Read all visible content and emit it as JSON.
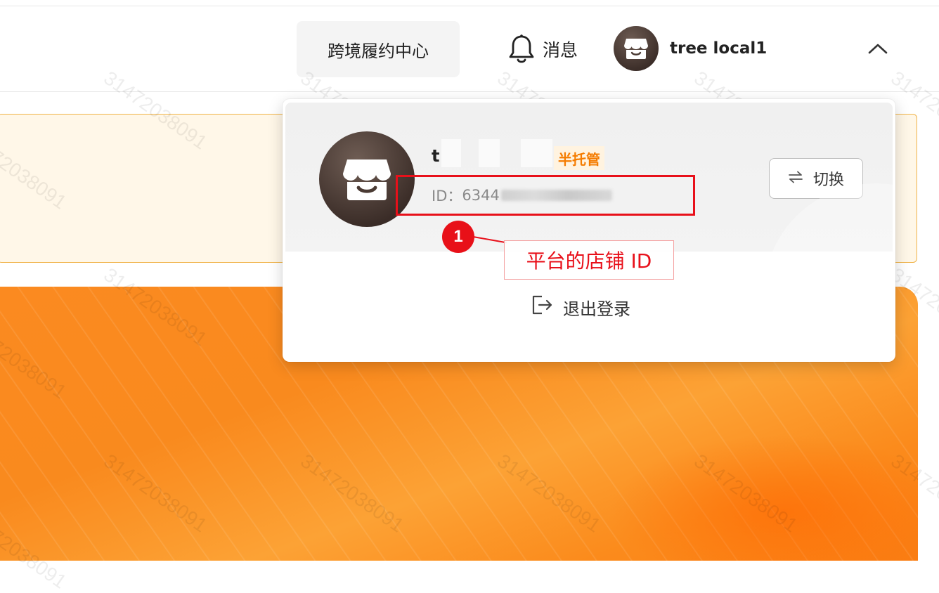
{
  "header": {
    "fulfillment_center_label": "跨境履约中心",
    "messages_label": "消息",
    "user_name": "tree local1"
  },
  "dropdown": {
    "shop_name": "t",
    "badge": "半托管",
    "shop_id_prefix": "ID：",
    "shop_id_visible": "6344",
    "switch_label": "切换",
    "logout_label": "退出登录"
  },
  "annotation": {
    "number": "1",
    "label": "平台的店铺 ID"
  },
  "watermark": "31472038091",
  "icons": {
    "bell": "bell-icon",
    "store": "store-icon",
    "chevron": "chevron-up-icon",
    "switch": "swap-arrows-icon",
    "logout": "logout-icon"
  },
  "colors": {
    "accent_orange": "#f57c00",
    "annotation_red": "#e8101a",
    "banner_orange": "#fb8a20"
  }
}
